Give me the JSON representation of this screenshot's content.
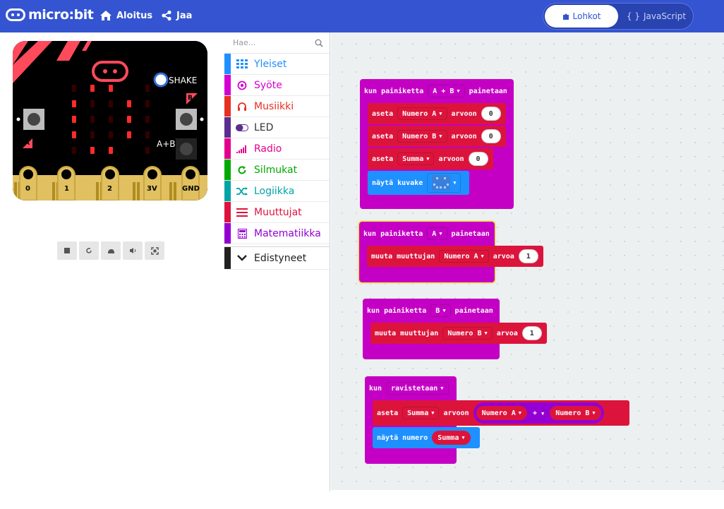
{
  "header": {
    "logo": "micro:bit",
    "home_label": "Aloitus",
    "share_label": "Jaa",
    "blocks_label": "Lohkot",
    "js_label": "JavaScript",
    "colors": {
      "bar": "#3454d1"
    }
  },
  "simulator": {
    "shake_label": "SHAKE",
    "button_a": "A",
    "button_b": "B",
    "button_ab": "A+B",
    "pins": [
      "0",
      "1",
      "2",
      "3V",
      "GND"
    ],
    "controls": [
      "stop-icon",
      "restart-icon",
      "slowmo-icon",
      "mute-icon",
      "fullscreen-icon"
    ]
  },
  "toolbox": {
    "search_placeholder": "Hae...",
    "items": [
      {
        "label": "Yleiset",
        "color": "#1e90ff",
        "icon": "grid-icon"
      },
      {
        "label": "Syöte",
        "color": "#d400d4",
        "icon": "target-icon"
      },
      {
        "label": "Musiikki",
        "color": "#e63022",
        "icon": "headphones-icon"
      },
      {
        "label": "LED",
        "color": "#5c2d91",
        "icon": "toggle-icon"
      },
      {
        "label": "Radio",
        "color": "#e3008c",
        "icon": "signal-icon"
      },
      {
        "label": "Silmukat",
        "color": "#00aa00",
        "icon": "loop-icon"
      },
      {
        "label": "Logiikka",
        "color": "#00a4a6",
        "icon": "shuffle-icon"
      },
      {
        "label": "Muuttujat",
        "color": "#dc143c",
        "icon": "lines-icon"
      },
      {
        "label": "Matematiikka",
        "color": "#9400d3",
        "icon": "calculator-icon"
      }
    ],
    "advanced": {
      "label": "Edistyneet",
      "color": "#212121",
      "icon": "chevron-down-icon"
    }
  },
  "workspace": {
    "block1": {
      "hat_prefix": "kun painiketta",
      "hat_button": "A + B",
      "hat_suffix": "painetaan",
      "rows": [
        {
          "verb": "aseta",
          "var": "Numero A",
          "to": "arvoon",
          "value": "0"
        },
        {
          "verb": "aseta",
          "var": "Numero B",
          "to": "arvoon",
          "value": "0"
        },
        {
          "verb": "aseta",
          "var": "Summa",
          "to": "arvoon",
          "value": "0"
        }
      ],
      "show_icon": "näytä kuvake"
    },
    "block2": {
      "hat_prefix": "kun painiketta",
      "hat_button": "A",
      "hat_suffix": "painetaan",
      "change_verb": "muuta muuttujan",
      "var": "Numero A",
      "by": "arvoa",
      "value": "1"
    },
    "block3": {
      "hat_prefix": "kun painiketta",
      "hat_button": "B",
      "hat_suffix": "painetaan",
      "change_verb": "muuta muuttujan",
      "var": "Numero B",
      "by": "arvoa",
      "value": "1"
    },
    "block4": {
      "hat_prefix": "kun",
      "hat_event": "ravistetaan",
      "set_verb": "aseta",
      "set_var": "Summa",
      "to": "arvoon",
      "operand_a": "Numero A",
      "operator": "+",
      "operand_b": "Numero B",
      "show_number": "näytä numero",
      "show_var": "Summa"
    }
  },
  "colors": {
    "input": "#c400c4",
    "variables": "#dc143c",
    "basic": "#1e90ff",
    "math": "#9400d3",
    "workspace_bg": "#ecf0f1"
  }
}
